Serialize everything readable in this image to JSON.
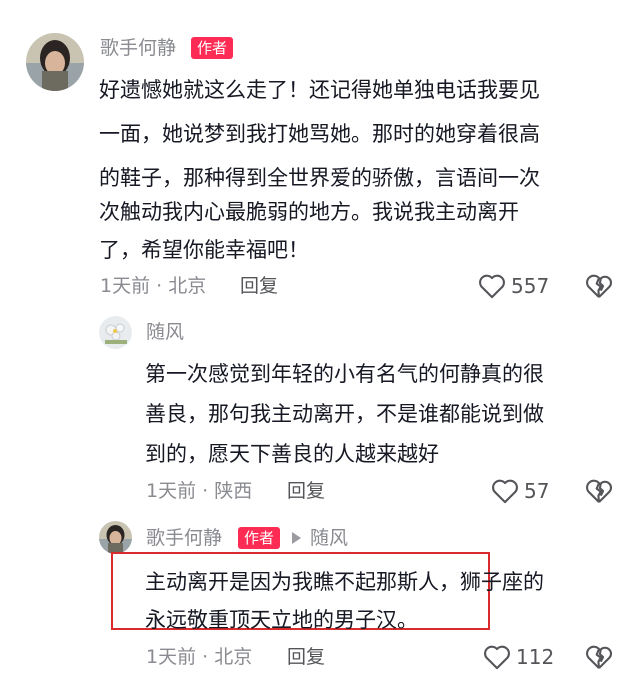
{
  "comments": [
    {
      "author": "歌手何静",
      "badge": "作者",
      "lines": [
        "好遗憾她就这么走了！还记得她单独电话我要见",
        "一面，她说梦到我打她骂她。那时的她穿着很高",
        "的鞋子，那种得到全世界爱的骄傲，言语间一次",
        "次触动我内心最脆弱的地方。我说我主动离开",
        "了，希望你能幸福吧！"
      ],
      "meta": "1天前 · 北京",
      "reply_label": "回复",
      "likes": "557"
    },
    {
      "author": "随风",
      "lines": [
        "第一次感觉到年轻的小有名气的何静真的很",
        "善良，那句我主动离开，不是谁都能说到做",
        "到的，愿天下善良的人越来越好"
      ],
      "meta": "1天前 · 陕西",
      "reply_label": "回复",
      "likes": "57"
    },
    {
      "author": "歌手何静",
      "badge": "作者",
      "reply_to": "随风",
      "lines": [
        "主动离开是因为我瞧不起那斯人，狮子座的",
        "永远敬重顶天立地的男子汉。"
      ],
      "meta": "1天前 · 北京",
      "reply_label": "回复",
      "likes": "112"
    }
  ],
  "icons": {
    "like": "heart-outline-icon",
    "dislike": "broken-heart-icon",
    "reply_arrow": "triangle-right-icon"
  },
  "colors": {
    "badge": "#fe2c55",
    "secondary_text": "#8a8b91",
    "highlight_box": "#d92b2b"
  }
}
